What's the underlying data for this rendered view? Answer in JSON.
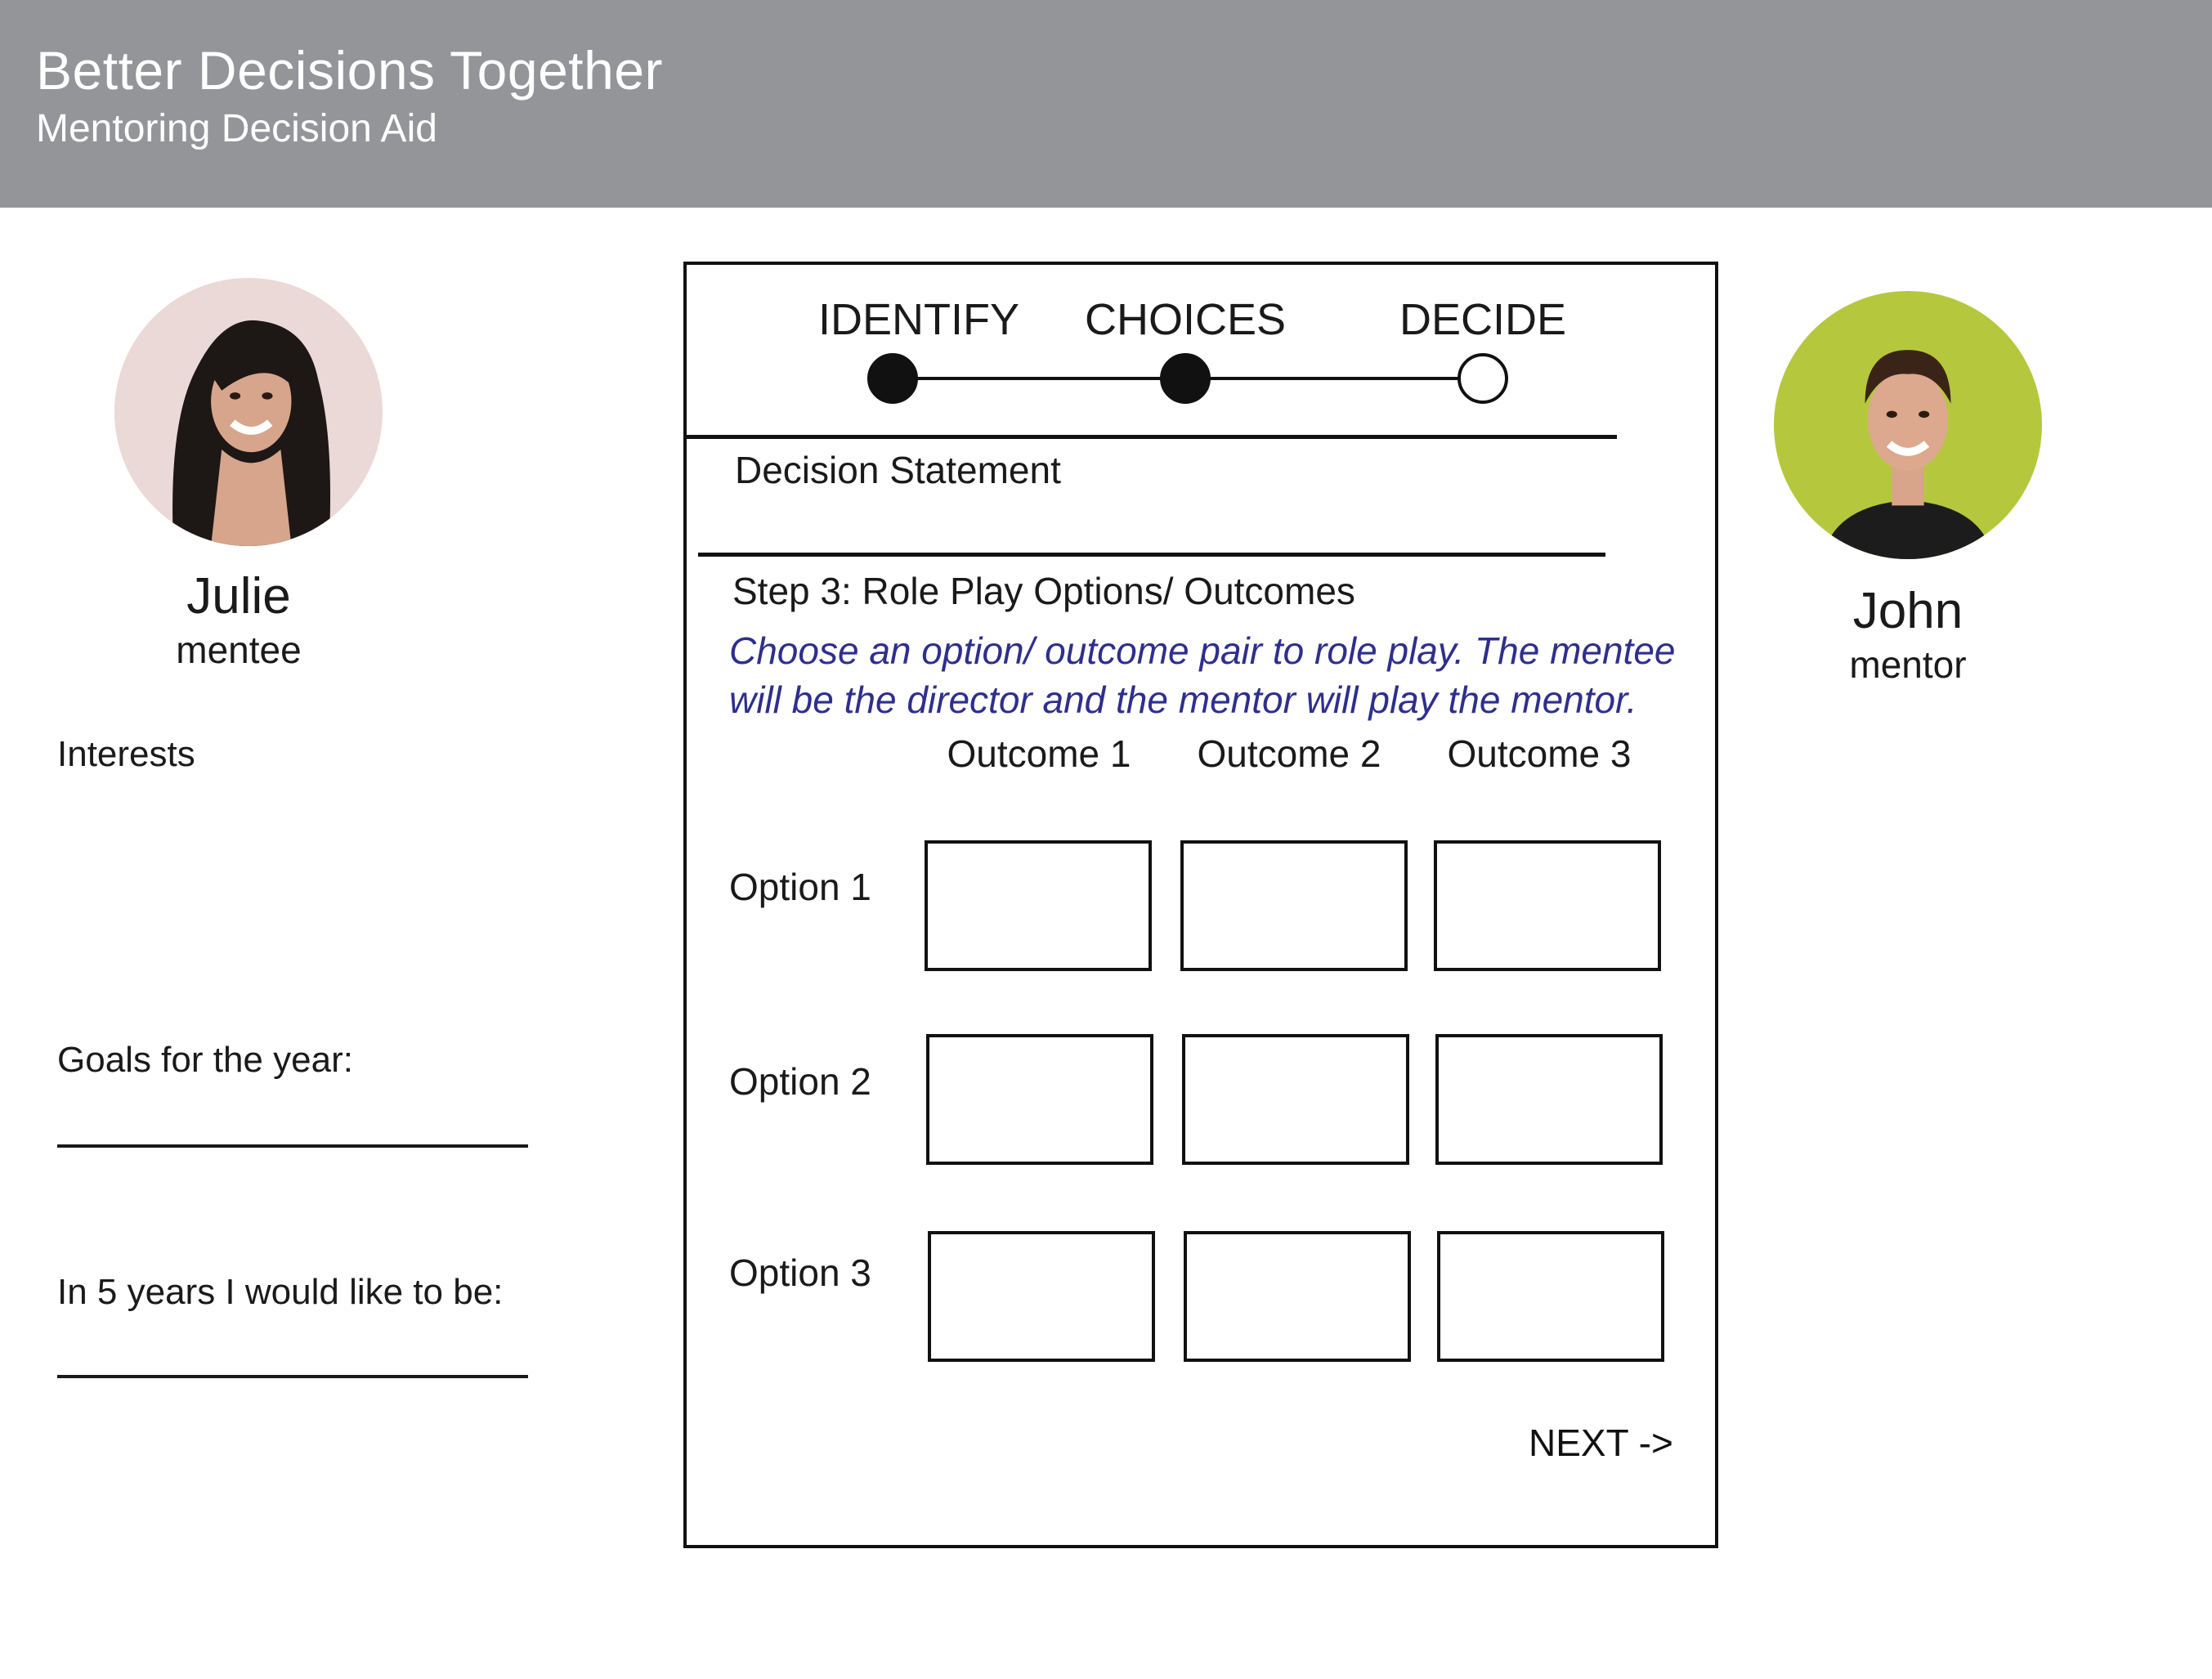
{
  "header": {
    "title": "Better Decisions Together",
    "subtitle": "Mentoring Decision Aid"
  },
  "mentee": {
    "name": "Julie",
    "role": "mentee",
    "interests_label": "Interests",
    "goals_label": "Goals for the year:",
    "five_years_label": "In 5 years I would like to be:"
  },
  "mentor": {
    "name": "John",
    "role": "mentor"
  },
  "stepper": {
    "steps": [
      {
        "label": "IDENTIFY",
        "status": "complete"
      },
      {
        "label": "CHOICES",
        "status": "complete"
      },
      {
        "label": "DECIDE",
        "status": "incomplete"
      }
    ]
  },
  "decision_statement_label": "Decision Statement",
  "step": {
    "title": "Step 3: Role Play Options/ Outcomes",
    "instructions": "Choose an option/ outcome pair to role play. The mentee will be the director and the mentor will play the mentor."
  },
  "grid": {
    "outcomes": [
      "Outcome 1",
      "Outcome 2",
      "Outcome 3"
    ],
    "options": [
      "Option 1",
      "Option 2",
      "Option 3"
    ]
  },
  "next_label": "NEXT ->",
  "colors": {
    "header_bg": "#939598",
    "instruction_text": "#2e2f8c",
    "mentor_avatar_bg": "#b5c83d"
  }
}
